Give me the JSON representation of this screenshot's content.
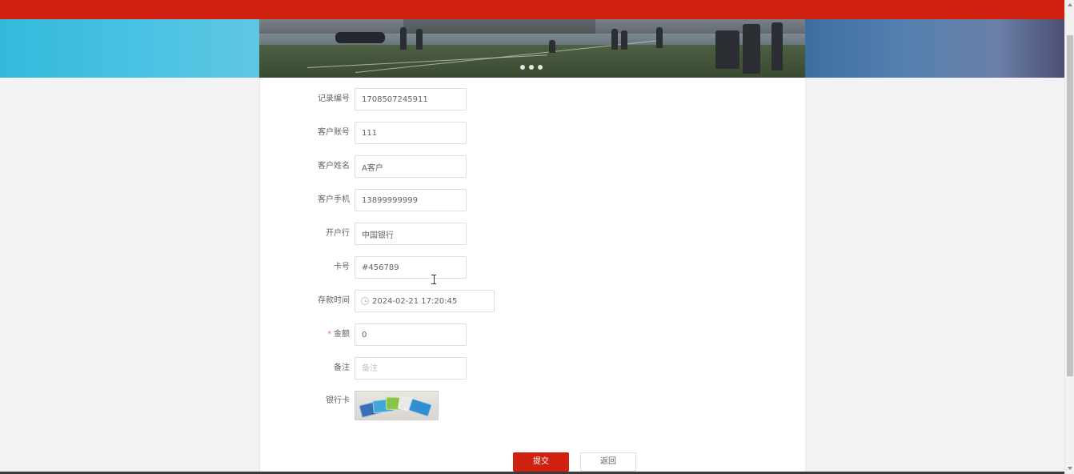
{
  "colors": {
    "brand_red": "#d0200f",
    "panel_bg": "#ffffff",
    "page_bg": "#f2f2f2",
    "input_border": "#dcdfe6",
    "required_star": "#f56c6c"
  },
  "banner": {
    "slide_count": 3,
    "active_slide": 1
  },
  "form": {
    "record_no": {
      "label": "记录编号",
      "value": "1708507245911"
    },
    "customer_account": {
      "label": "客户账号",
      "value": "111"
    },
    "customer_name": {
      "label": "客户姓名",
      "value": "A客户"
    },
    "customer_phone": {
      "label": "客户手机",
      "value": "13899999999"
    },
    "bank": {
      "label": "开户行",
      "value": "中国银行"
    },
    "card_no": {
      "label": "卡号",
      "value": "#456789"
    },
    "deposit_time": {
      "label": "存款时间",
      "value": "2024-02-21 17:20:45",
      "icon": "clock-icon"
    },
    "amount": {
      "label": "金额",
      "required_mark": "*",
      "value": "0"
    },
    "remark": {
      "label": "备注",
      "value": "",
      "placeholder": "备注"
    },
    "bank_card": {
      "label": "银行卡"
    }
  },
  "buttons": {
    "submit": "提交",
    "back": "返回"
  }
}
